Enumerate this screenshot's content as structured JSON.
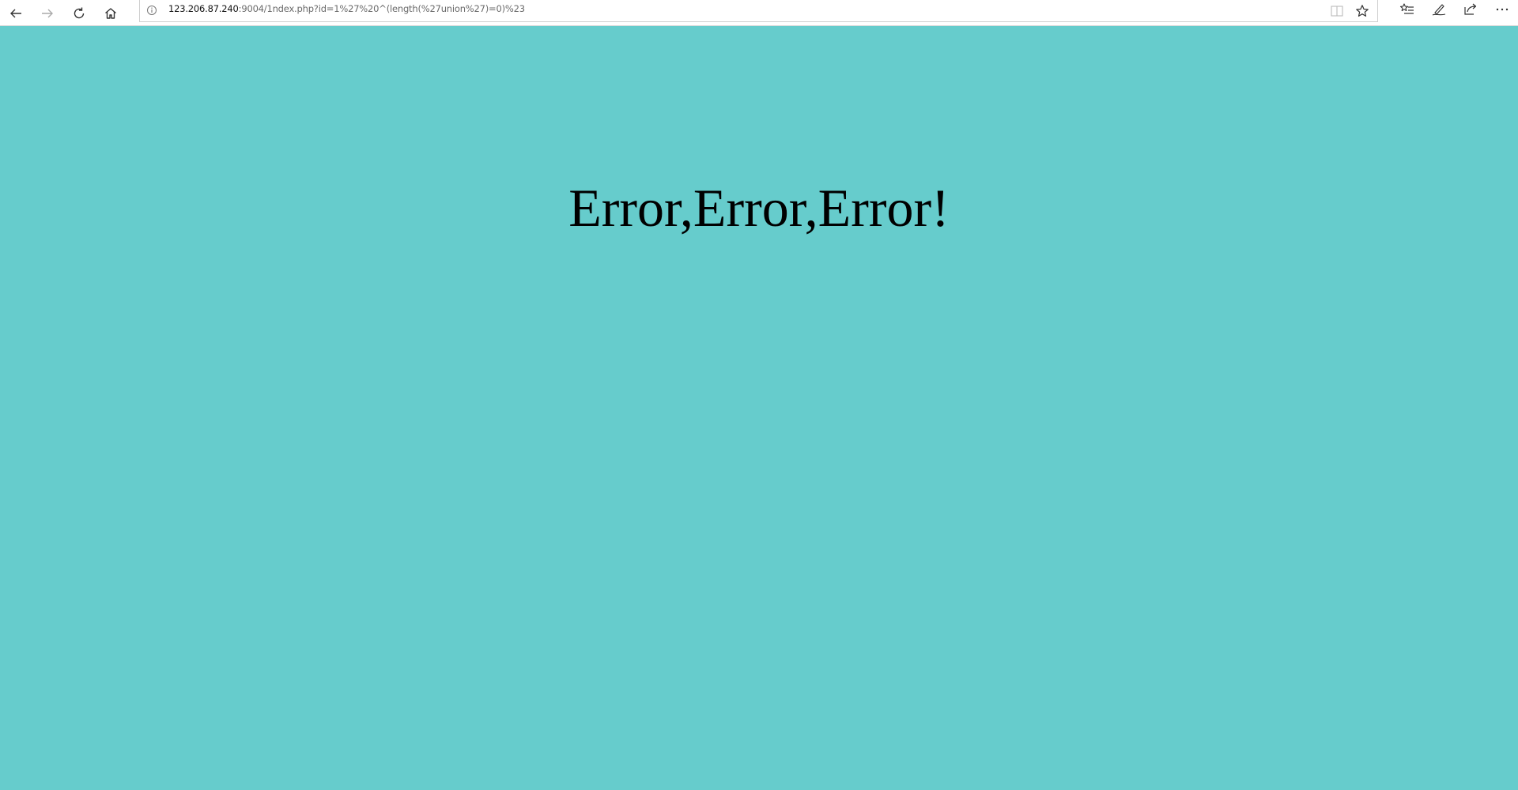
{
  "browser": {
    "address_host": "123.206.87.240",
    "address_rest": ":9004/1ndex.php?id=1%27%20^(length(%27union%27)=0)%23",
    "icons": {
      "back": "back-arrow-icon",
      "forward": "forward-arrow-icon",
      "refresh": "refresh-icon",
      "home": "home-icon",
      "site_info": "info-icon",
      "reading_view": "reading-view-icon",
      "favorite": "star-icon",
      "favorites_hub": "favorites-list-icon",
      "notes": "pen-icon",
      "share": "share-icon",
      "more": "more-icon"
    }
  },
  "page": {
    "background_color": "#66cccc",
    "heading": "Error,Error,Error!"
  }
}
